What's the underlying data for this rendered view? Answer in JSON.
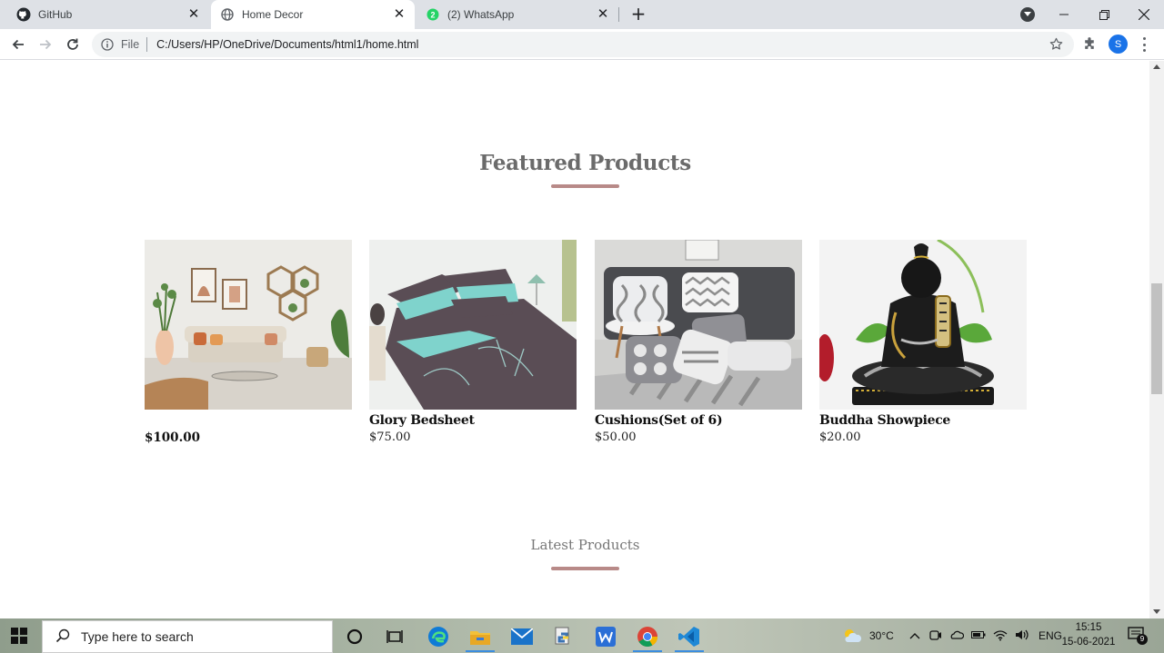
{
  "browser": {
    "tabs": [
      {
        "title": "GitHub",
        "icon": "github-icon",
        "active": false
      },
      {
        "title": "Home Decor",
        "icon": "globe-icon",
        "active": true
      },
      {
        "title": "(2) WhatsApp",
        "icon": "whatsapp-icon",
        "active": false,
        "badge": "2"
      }
    ],
    "address": {
      "scheme_label": "File",
      "url": "C:/Users/HP/OneDrive/Documents/html1/home.html"
    },
    "profile_initial": "S"
  },
  "page": {
    "featured_title": "Featured Products",
    "latest_title": "Latest Products",
    "accent_color": "#b88a88",
    "products": [
      {
        "name": "",
        "price": "$100.00",
        "image": "living-room-image"
      },
      {
        "name": "Glory Bedsheet",
        "price": "$75.00",
        "image": "bedsheet-image"
      },
      {
        "name": "Cushions(Set of 6)",
        "price": "$50.00",
        "image": "cushions-image"
      },
      {
        "name": "Buddha Showpiece",
        "price": "$20.00",
        "image": "buddha-image"
      }
    ]
  },
  "taskbar": {
    "search_placeholder": "Type here to search",
    "weather": "30°C",
    "language": "ENG",
    "time": "15:15",
    "date": "15-06-2021",
    "notifications": "9"
  }
}
